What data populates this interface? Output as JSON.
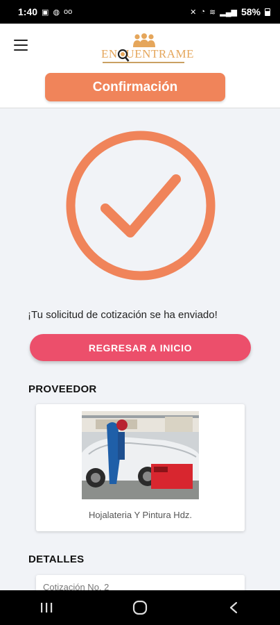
{
  "status_bar": {
    "time": "1:40",
    "battery": "58%",
    "left_icons": [
      "image-icon",
      "whatsapp-icon",
      "voicemail-icon"
    ],
    "right_icons": [
      "mute-icon",
      "alarm-icon",
      "wifi-icon",
      "signal-icon",
      "battery-icon"
    ]
  },
  "header": {
    "logo_text": "ENCUENTRAME",
    "title": "Confirmación",
    "accent_color": "#f0845a"
  },
  "confirmation": {
    "icon": "check-circle-icon",
    "message": "¡Tu solicitud de cotización se ha enviado!",
    "home_button": "REGRESAR A INICIO",
    "button_color": "#ec4f6b"
  },
  "provider": {
    "section_title": "PROVEEDOR",
    "name": "Hojalateria Y Pintura Hdz."
  },
  "details": {
    "section_title": "DETALLES",
    "quote_number": "Cotización No. 2"
  },
  "nav_bar": {
    "items": [
      "recents-icon",
      "home-icon",
      "back-icon"
    ]
  }
}
